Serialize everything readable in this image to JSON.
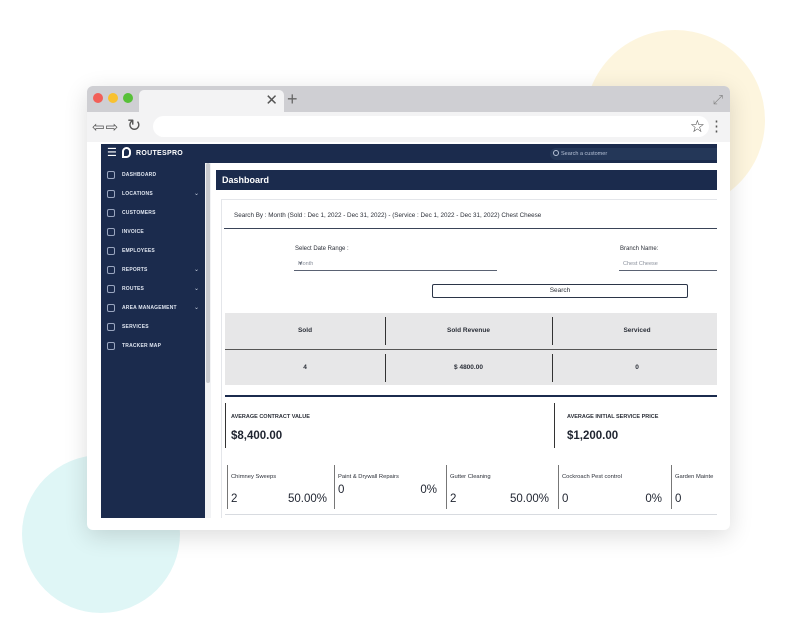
{
  "app": {
    "brand": "ROUTESPRO",
    "search_placeholder": "Search a customer"
  },
  "sidebar": {
    "items": [
      {
        "label": "DASHBOARD",
        "chevron": false,
        "icon": "dashboard-icon"
      },
      {
        "label": "LOCATIONS",
        "chevron": true,
        "icon": "location-icon"
      },
      {
        "label": "CUSTOMERS",
        "chevron": false,
        "icon": "customers-icon"
      },
      {
        "label": "INVOICE",
        "chevron": false,
        "icon": "invoice-icon"
      },
      {
        "label": "EMPLOYEES",
        "chevron": false,
        "icon": "employees-icon"
      },
      {
        "label": "REPORTS",
        "chevron": true,
        "icon": "reports-icon"
      },
      {
        "label": "ROUTES",
        "chevron": true,
        "icon": "routes-icon"
      },
      {
        "label": "AREA MANAGEMENT",
        "chevron": true,
        "icon": "area-icon"
      },
      {
        "label": "SERVICES",
        "chevron": false,
        "icon": "services-icon"
      },
      {
        "label": "TRACKER MAP",
        "chevron": false,
        "icon": "map-icon"
      }
    ]
  },
  "page": {
    "title": "Dashboard",
    "search_summary": "Search By : Month (Sold : Dec 1, 2022 - Dec 31, 2022) - (Service : Dec 1, 2022 - Dec 31, 2022) Chest Cheese",
    "date_range_label": "Select Date Range :",
    "date_range_value": "Month",
    "branch_label": "Branch Name:",
    "branch_value": "Chest Cheese",
    "search_button": "Search"
  },
  "stats": {
    "headers": [
      "Sold",
      "Sold Revenue",
      "Serviced"
    ],
    "values": [
      "4",
      "$ 4800.00",
      "0"
    ]
  },
  "averages": [
    {
      "label": "AVERAGE CONTRACT VALUE",
      "value": "$8,400.00"
    },
    {
      "label": "AVERAGE INITIAL SERVICE PRICE",
      "value": "$1,200.00"
    }
  ],
  "services": [
    {
      "name": "Chimney Sweeps",
      "count": "2",
      "pct": "50.00%"
    },
    {
      "name": "Paint & Drywall Repairs",
      "count": "0",
      "pct": "0%"
    },
    {
      "name": "Gutter Cleaning",
      "count": "2",
      "pct": "50.00%"
    },
    {
      "name": "Cockroach Pest control",
      "count": "0",
      "pct": "0%"
    },
    {
      "name": "Garden Mainte",
      "count": "0",
      "pct": ""
    }
  ],
  "colors": {
    "navy": "#1b2b4d",
    "stats_bg": "#e7e7e8"
  }
}
